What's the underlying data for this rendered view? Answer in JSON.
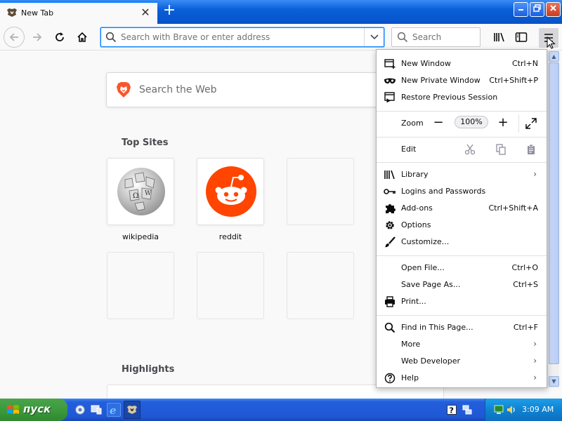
{
  "tab": {
    "title": "New Tab",
    "close_glyph": "✕",
    "new_glyph": "+"
  },
  "window_controls": {
    "minimize": "▁",
    "maximize": "❐",
    "close": "✕"
  },
  "urlbar": {
    "placeholder": "Search with Brave or enter address",
    "value": ""
  },
  "searchbar": {
    "placeholder": "Search",
    "value": ""
  },
  "content": {
    "web_search_placeholder": "Search the Web",
    "top_sites_title": "Top Sites",
    "highlights_title": "Highlights",
    "sites": [
      {
        "label": "wikipedia",
        "icon": "wikipedia-globe-icon"
      },
      {
        "label": "reddit",
        "icon": "reddit-alien-icon"
      }
    ]
  },
  "menu": {
    "new_window": {
      "label": "New Window",
      "shortcut": "Ctrl+N"
    },
    "new_private_window": {
      "label": "New Private Window",
      "shortcut": "Ctrl+Shift+P"
    },
    "restore_session": {
      "label": "Restore Previous Session"
    },
    "zoom": {
      "label": "Zoom",
      "value": "100%",
      "minus": "−",
      "plus": "+"
    },
    "edit": {
      "label": "Edit"
    },
    "library": {
      "label": "Library",
      "arrow": "›"
    },
    "logins": {
      "label": "Logins and Passwords"
    },
    "addons": {
      "label": "Add-ons",
      "shortcut": "Ctrl+Shift+A"
    },
    "options": {
      "label": "Options"
    },
    "customize": {
      "label": "Customize..."
    },
    "open_file": {
      "label": "Open File...",
      "shortcut": "Ctrl+O"
    },
    "save_page": {
      "label": "Save Page As...",
      "shortcut": "Ctrl+S"
    },
    "print": {
      "label": "Print..."
    },
    "find": {
      "label": "Find in This Page...",
      "shortcut": "Ctrl+F"
    },
    "more": {
      "label": "More",
      "arrow": "›"
    },
    "web_developer": {
      "label": "Web Developer",
      "arrow": "›"
    },
    "help": {
      "label": "Help",
      "arrow": "›"
    }
  },
  "taskbar": {
    "start_label": "пуск",
    "clock": "3:09 AM"
  },
  "colors": {
    "accent": "#0a84ff",
    "brave_orange": "#fb542b",
    "reddit_orange": "#ff4500",
    "xp_blue": "#245edb",
    "start_green": "#3c9a3c"
  }
}
